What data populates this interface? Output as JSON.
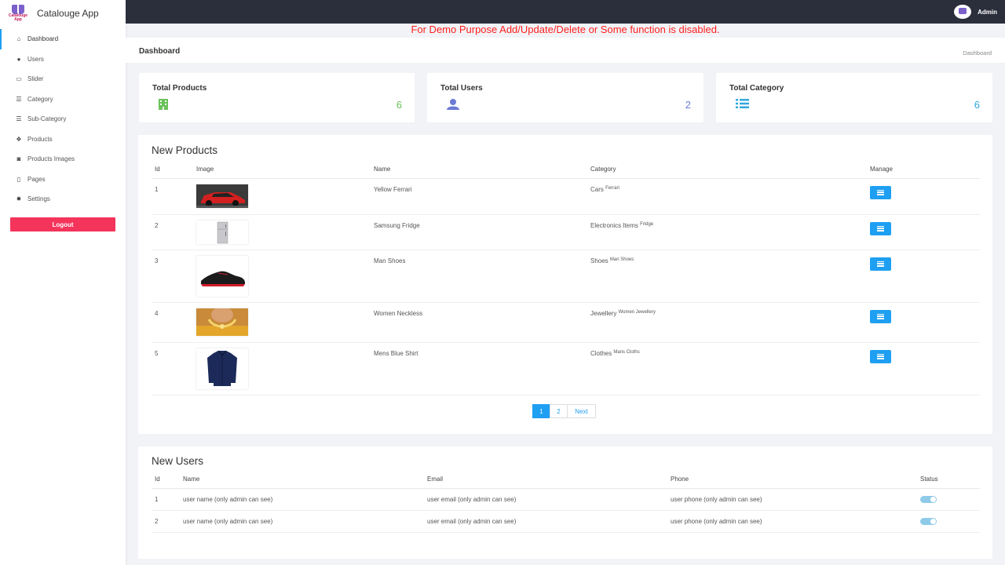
{
  "brand": {
    "name": "Catalouge App",
    "logo_text": "Catalouge App"
  },
  "sidebar": {
    "items": [
      {
        "label": "Dashboard",
        "icon": "home-icon",
        "glyph": "⌂",
        "active": true
      },
      {
        "label": "Users",
        "icon": "user-icon",
        "glyph": "●"
      },
      {
        "label": "Slider",
        "icon": "image-icon",
        "glyph": "▭"
      },
      {
        "label": "Category",
        "icon": "list-icon",
        "glyph": "☰"
      },
      {
        "label": "Sub-Category",
        "icon": "list-icon",
        "glyph": "☰"
      },
      {
        "label": "Products",
        "icon": "cubes-icon",
        "glyph": "❖"
      },
      {
        "label": "Products Images",
        "icon": "camera-icon",
        "glyph": "◙"
      },
      {
        "label": "Pages",
        "icon": "page-icon",
        "glyph": "▯"
      },
      {
        "label": "Settings",
        "icon": "gear-icon",
        "glyph": "✹"
      }
    ],
    "logout_label": "Logout"
  },
  "topbar": {
    "user_name": "Admin"
  },
  "notice": "For Demo Purpose Add/Update/Delete or Some function is disabled.",
  "page": {
    "title": "Dashboard",
    "breadcrumb": "Dashboard"
  },
  "stats": [
    {
      "title": "Total Products",
      "value": "6",
      "icon": "building-icon",
      "color": "#6ac259"
    },
    {
      "title": "Total Users",
      "value": "2",
      "icon": "user-icon",
      "color": "#6c7ad4"
    },
    {
      "title": "Total Category",
      "value": "6",
      "icon": "list-icon",
      "color": "#2fa7dd"
    }
  ],
  "new_products": {
    "title": "New Products",
    "columns": [
      "Id",
      "Image",
      "Name",
      "Category",
      "Manage"
    ],
    "rows": [
      {
        "id": "1",
        "name": "Yellow Ferrari",
        "category": "Cars",
        "sub": "Ferrari",
        "image": "car"
      },
      {
        "id": "2",
        "name": "Samsung Fridge",
        "category": "Electronics Items",
        "sub": "Fridge",
        "image": "fridge"
      },
      {
        "id": "3",
        "name": "Man Shoes",
        "category": "Shoes",
        "sub": "Man Shoes",
        "image": "shoe"
      },
      {
        "id": "4",
        "name": "Women Neckless",
        "category": "Jewellery",
        "sub": "Women Jewellery",
        "image": "necklace"
      },
      {
        "id": "5",
        "name": "Mens Blue Shirt",
        "category": "Clothes",
        "sub": "Mans Cloths",
        "image": "shirt"
      }
    ],
    "pagination": {
      "pages": [
        "1",
        "2"
      ],
      "next": "Next",
      "current": "1"
    }
  },
  "new_users": {
    "title": "New Users",
    "columns": [
      "Id",
      "Name",
      "Email",
      "Phone",
      "Status"
    ],
    "rows": [
      {
        "id": "1",
        "name": "user name (only admin can see)",
        "email": "user email (only admin can see)",
        "phone": "user phone (only admin can see)",
        "status": true
      },
      {
        "id": "2",
        "name": "user name (only admin can see)",
        "email": "user email (only admin can see)",
        "phone": "user phone (only admin can see)",
        "status": true
      }
    ]
  },
  "colors": {
    "accent": "#1e9ff2",
    "danger": "#f4345b",
    "topbar": "#2b2e3b",
    "notice": "#ff1f1f"
  }
}
